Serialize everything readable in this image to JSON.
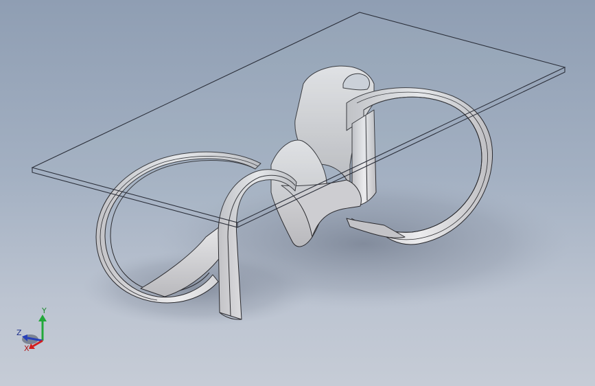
{
  "viewport": {
    "background_top": "#8f9eb3",
    "background_bottom": "#c6ccd6",
    "model": {
      "part_color": "#d9d9db",
      "edge_color": "#2a2a2e",
      "glass_edge_color": "#2b2f3a"
    }
  },
  "triad": {
    "x_label": "X",
    "y_label": "Y",
    "z_label": "Z",
    "x_color": "#d21f1f",
    "y_color": "#22a83a",
    "z_color": "#2740b8"
  }
}
